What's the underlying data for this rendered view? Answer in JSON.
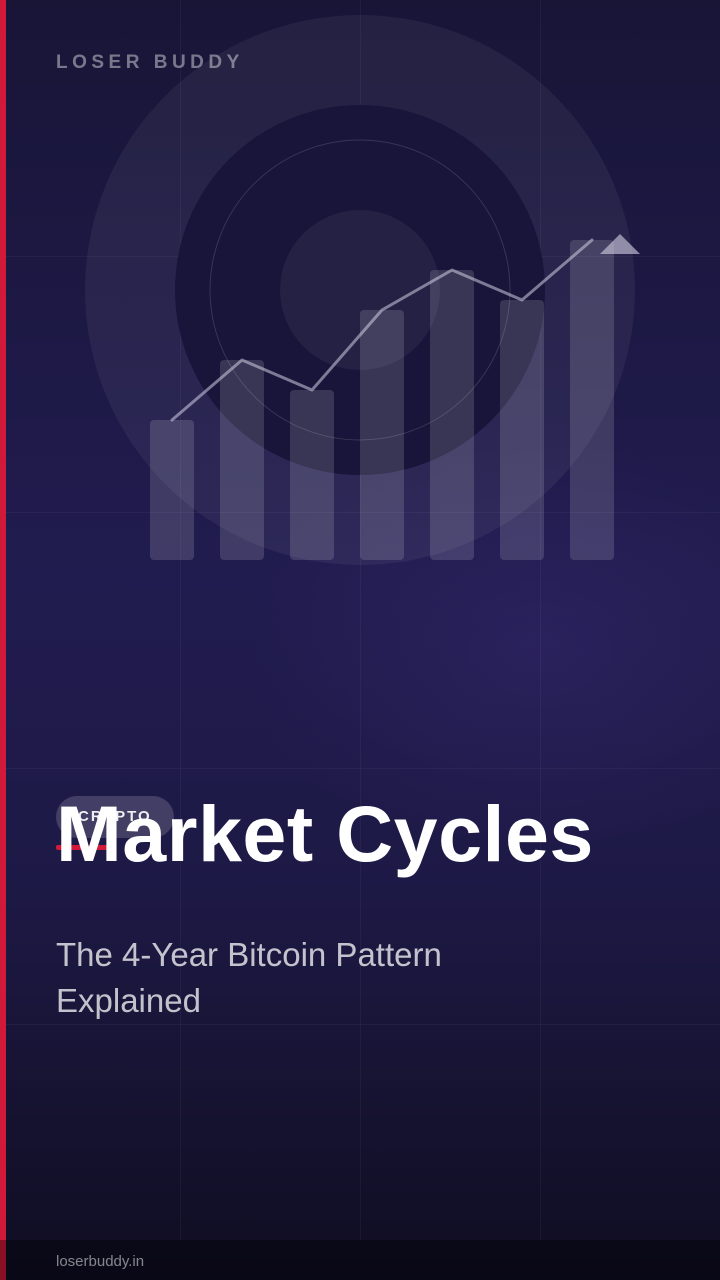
{
  "brand": {
    "name": "LOSER BUDDY",
    "accent_color": "#d11a3a"
  },
  "hero": {
    "icon": "rising-bar-chart-with-trend-arrow",
    "bar_levels": [
      0.28,
      0.4,
      0.34,
      0.5,
      0.58,
      0.52,
      0.64
    ],
    "trend_levels": [
      0.28,
      0.4,
      0.34,
      0.5,
      0.58,
      0.52,
      0.64
    ]
  },
  "category": {
    "label": "CRYPTO"
  },
  "headline": {
    "title": "Market Cycles",
    "subtitle": "The 4-Year Bitcoin Pattern Explained"
  },
  "footer": {
    "url": "loserbuddy.in"
  },
  "colors": {
    "background": "#1c1842",
    "accent": "#d11a3a",
    "text_primary": "#ffffff"
  }
}
